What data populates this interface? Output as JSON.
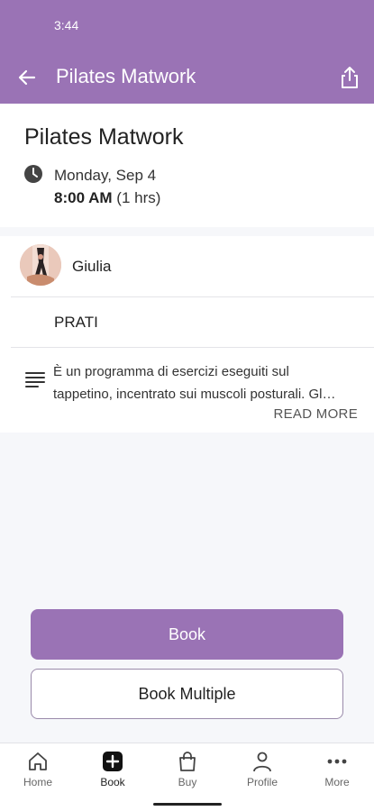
{
  "status_bar": {
    "time": "3:44"
  },
  "app_bar": {
    "title": "Pilates Matwork"
  },
  "class": {
    "title": "Pilates Matwork",
    "date": "Monday, Sep 4",
    "time": "8:00 AM",
    "duration": "(1 hrs)"
  },
  "instructor": {
    "name": "Giulia"
  },
  "location": "PRATI",
  "description": {
    "line1": "È un programma di esercizi eseguiti sul",
    "line2": "tappetino, incentrato sui muscoli posturali. Gl…",
    "read_more": "READ MORE"
  },
  "actions": {
    "book": "Book",
    "book_multiple": "Book Multiple"
  },
  "bottom_nav": {
    "home": "Home",
    "book": "Book",
    "buy": "Buy",
    "profile": "Profile",
    "more": "More"
  },
  "colors": {
    "accent": "#9a73b5"
  }
}
